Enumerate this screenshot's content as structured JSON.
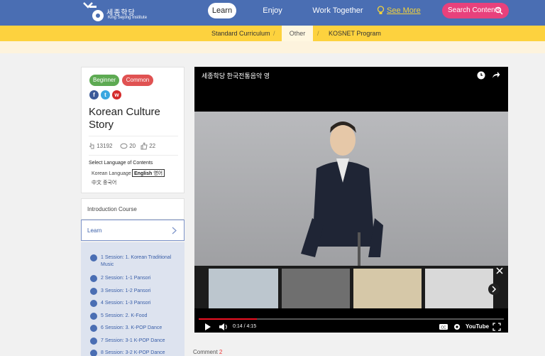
{
  "header": {
    "logo_korean": "세종학당",
    "logo_english": "King Sejong Institute",
    "nav": {
      "learn": "Learn",
      "enjoy": "Enjoy",
      "work_together": "Work Together",
      "see_more": "See More",
      "search": "Search Contents"
    }
  },
  "subnav": {
    "items": [
      "Standard Curriculum",
      "Other",
      "KOSNET Program"
    ],
    "separator": "/",
    "active": "Other"
  },
  "course": {
    "badges": [
      "Beginner",
      "Common"
    ],
    "title": "Korean Culture Story",
    "stats": {
      "views": "13192",
      "comments": "20",
      "likes": "22"
    },
    "language_title": "Select Language of Contents",
    "languages": [
      "Korean Language",
      "English",
      "영어",
      "中文 중국어"
    ],
    "selected_language": "English 영어"
  },
  "menu": {
    "intro": "Introduction Course",
    "learn": "Learn",
    "sessions": [
      "1 Session: 1. Korean Traditional Music",
      "2 Session: 1-1 Pansori",
      "3 Session: 1-2 Pansori",
      "4 Session: 1-3 Pansori",
      "5 Session: 2. K-Food",
      "6 Session: 3. K-POP Dance",
      "7 Session: 3-1 K-POP Dance",
      "8 Session: 3-2 K-POP Dance"
    ]
  },
  "video": {
    "title": "세종학당 한국전통음악 영",
    "time": "0:14 / 4:15",
    "progress_fraction": 0.19,
    "brand": "YouTube"
  },
  "comment": {
    "label": "Comment",
    "count": "2"
  },
  "colors": {
    "nav_blue": "#4a6eb3",
    "subnav_yellow": "#fdd23e",
    "search_pink": "#e8417c",
    "beginner_green": "#5daa52",
    "common_red": "#e05252",
    "session_panel": "#dde3ef"
  }
}
